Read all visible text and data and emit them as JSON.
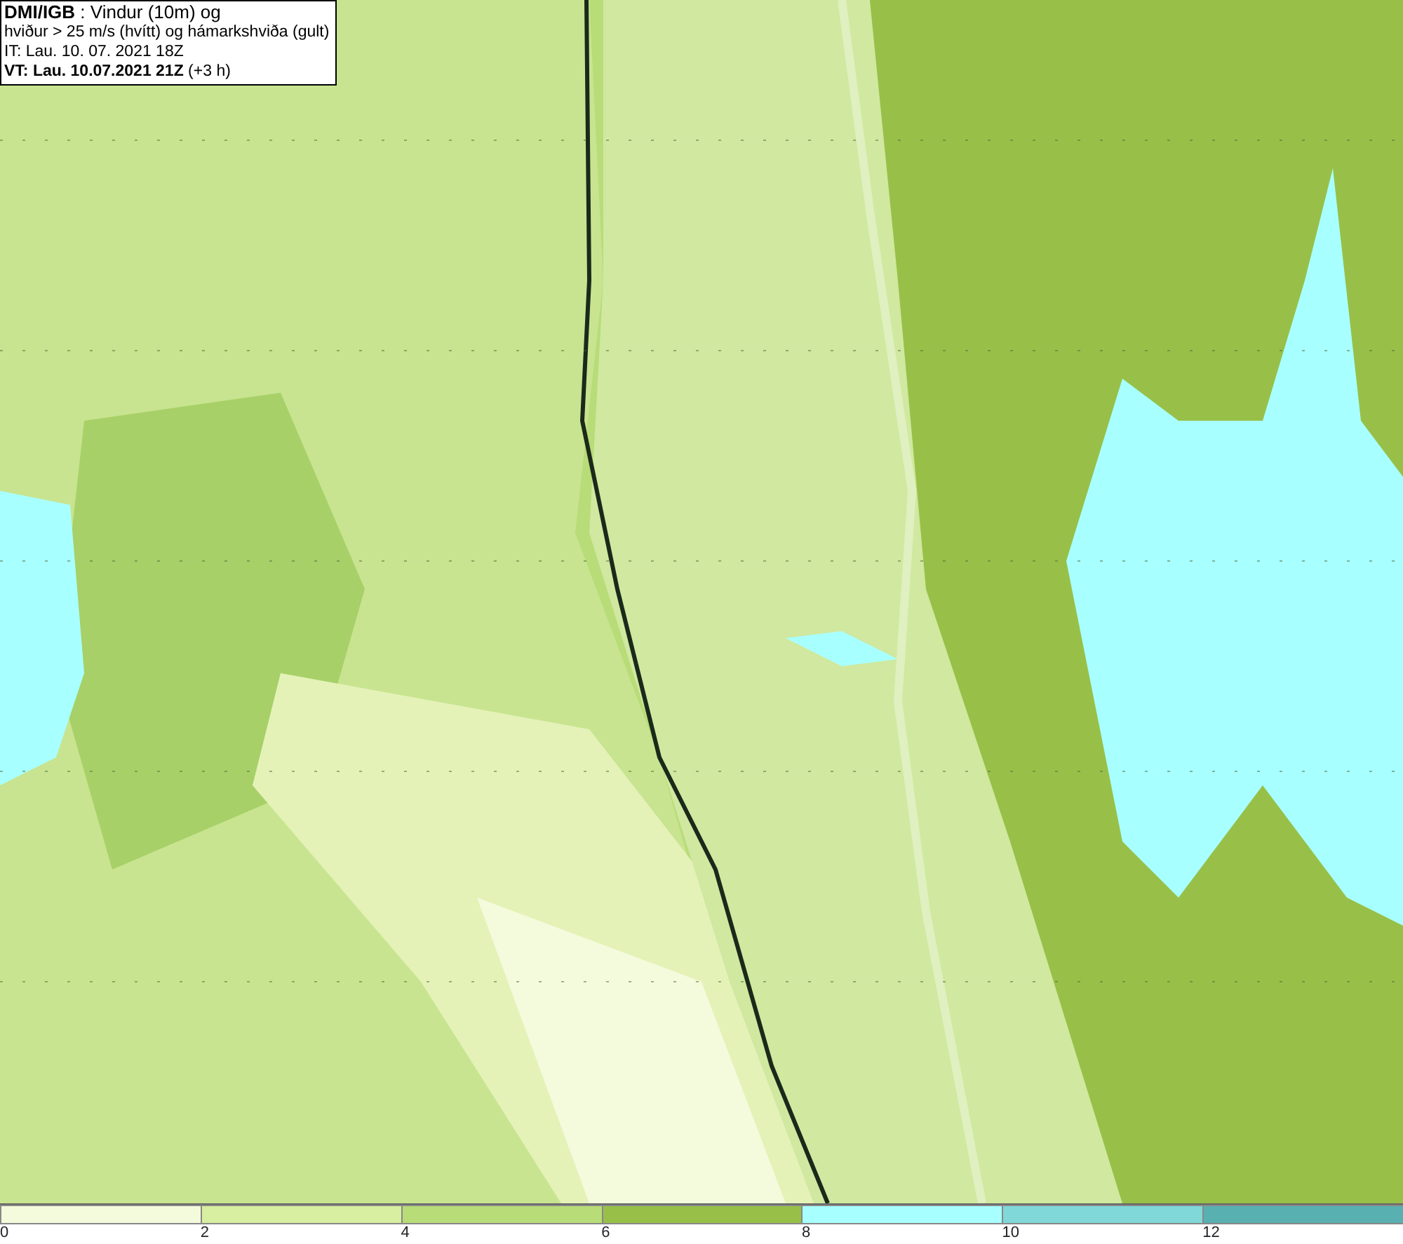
{
  "header": {
    "lines": [
      "**DMI/IGB** : Vindur (10m) og",
      "hviður > 25 m/s (hvítt) og hámarkshviða (gult)",
      "IT: Lau. 10. 07. 2021 18Z",
      "**VT: Lau. 10.07.2021 21Z** (+3 h)"
    ]
  },
  "legend": {
    "bins": [
      {
        "label": "0",
        "color": "#f4fadc"
      },
      {
        "label": "2",
        "color": "#d8eea0"
      },
      {
        "label": "4",
        "color": "#b8dc78"
      },
      {
        "label": "6",
        "color": "#98c048"
      },
      {
        "label": "8",
        "color": "#a8ffff"
      },
      {
        "label": "10",
        "color": "#80d8d8"
      },
      {
        "label": "12",
        "color": "#58b0b0"
      }
    ]
  }
}
